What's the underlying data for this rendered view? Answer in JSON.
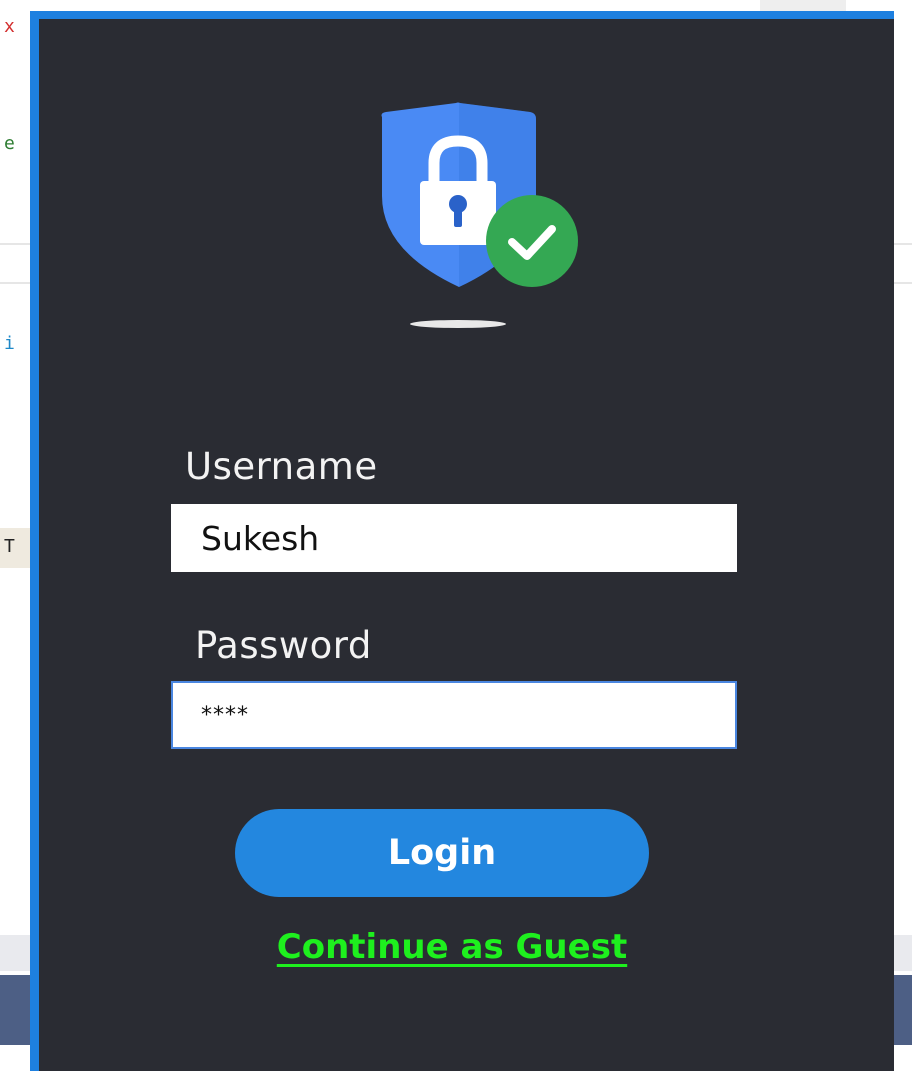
{
  "background": {
    "glyphs": [
      "x",
      "e",
      "i",
      "T"
    ]
  },
  "login": {
    "username_label": "Username",
    "username_value": "Sukesh",
    "password_label": "Password",
    "password_value": "****",
    "login_button": "Login",
    "guest_link": "Continue as Guest"
  },
  "colors": {
    "window_background": "#2a2c33",
    "window_border": "#1e80e0",
    "shield_blue": "#4a8af4",
    "check_green": "#34a853",
    "button_blue": "#2387df",
    "guest_link_green": "#1ef01e"
  },
  "icons": {
    "logo": "shield-lock-check-icon"
  }
}
